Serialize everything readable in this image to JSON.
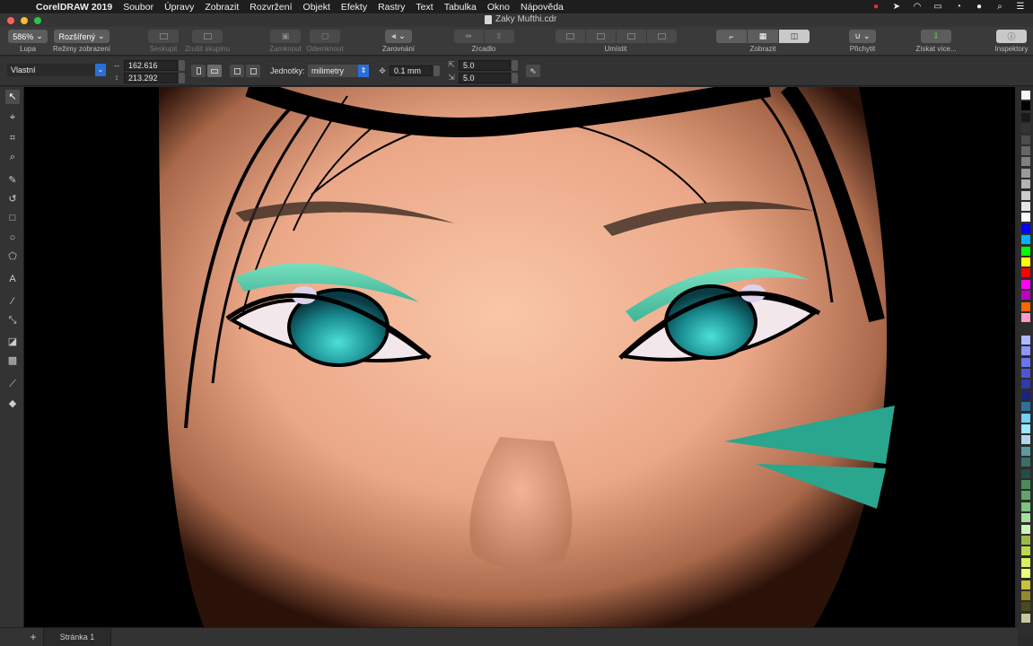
{
  "menubar": {
    "app_name": "CorelDRAW 2019",
    "items": [
      "Soubor",
      "Úpravy",
      "Zobrazit",
      "Rozvržení",
      "Objekt",
      "Efekty",
      "Rastry",
      "Text",
      "Tabulka",
      "Okno",
      "Nápověda"
    ]
  },
  "window": {
    "title": "Zaky Mufthi.cdr"
  },
  "toolbar": {
    "zoom_value": "586%",
    "zoom_label": "Lupa",
    "view_mode_value": "Rozšířený",
    "view_mode_label": "Režimy zobrazení",
    "group_label": "Seskupit",
    "ungroup_label": "Zrušit skupinu",
    "lock_label": "Zamknout",
    "unlock_label": "Odemknout",
    "align_label": "Zarovnání",
    "mirror_label": "Zrcadlo",
    "arrange_label": "Umístit",
    "view_label": "Zobrazit",
    "snap_label": "Přichytit",
    "get_more_label": "Získat více...",
    "inspectors_label": "Inspektory"
  },
  "propbar": {
    "preset_value": "Vlastní",
    "width_value": "162.616",
    "height_value": "213.292",
    "units_label": "Jednotky:",
    "units_value": "milimetry",
    "nudge_value": "0.1 mm",
    "dup_x_value": "5.0",
    "dup_y_value": "5.0"
  },
  "status": {
    "add_page": "+",
    "page_tab": "Stránka 1"
  },
  "palette": {
    "colors": [
      "#f7f7f7",
      "#000000",
      "#1a1a1a",
      "#333333",
      "#4d4d4d",
      "#666666",
      "#808080",
      "#999999",
      "#b3b3b3",
      "#cccccc",
      "#e6e6e6",
      "#ffffff",
      "#0000ff",
      "#00b5ff",
      "#00ff00",
      "#ffff00",
      "#ff0000",
      "#ff00ff",
      "#c000c0",
      "#ff6600",
      "#ff99cc",
      "#2d2d2d",
      "#b0b8ff",
      "#8d96ff",
      "#6a76f0",
      "#4c57d8",
      "#2e3ab0",
      "#1a237e",
      "#2f6f9f",
      "#6fd3f5",
      "#9ae7ff",
      "#b0d8e8",
      "#5c9aa0",
      "#3a6f6a",
      "#244c45",
      "#4b8b5b",
      "#62a56a",
      "#7fc47e",
      "#a1e29a",
      "#c8f5be",
      "#9cb848",
      "#b9d94c",
      "#d6f25c",
      "#eaff7a",
      "#c9c13a",
      "#8f8a2a",
      "#4a4a1e",
      "#c8c8a0"
    ]
  }
}
